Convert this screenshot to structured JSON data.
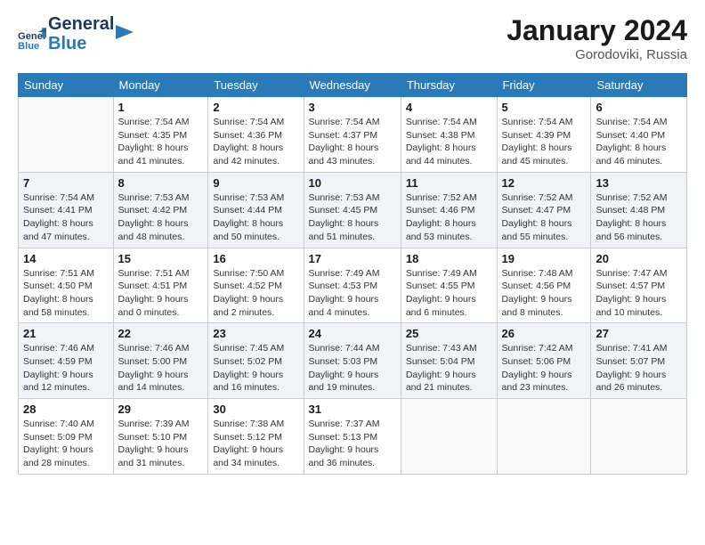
{
  "header": {
    "title": "January 2024",
    "location": "Gorodoviki, Russia"
  },
  "columns": [
    "Sunday",
    "Monday",
    "Tuesday",
    "Wednesday",
    "Thursday",
    "Friday",
    "Saturday"
  ],
  "weeks": [
    [
      {
        "day": "",
        "info": ""
      },
      {
        "day": "1",
        "info": "Sunrise: 7:54 AM\nSunset: 4:35 PM\nDaylight: 8 hours\nand 41 minutes."
      },
      {
        "day": "2",
        "info": "Sunrise: 7:54 AM\nSunset: 4:36 PM\nDaylight: 8 hours\nand 42 minutes."
      },
      {
        "day": "3",
        "info": "Sunrise: 7:54 AM\nSunset: 4:37 PM\nDaylight: 8 hours\nand 43 minutes."
      },
      {
        "day": "4",
        "info": "Sunrise: 7:54 AM\nSunset: 4:38 PM\nDaylight: 8 hours\nand 44 minutes."
      },
      {
        "day": "5",
        "info": "Sunrise: 7:54 AM\nSunset: 4:39 PM\nDaylight: 8 hours\nand 45 minutes."
      },
      {
        "day": "6",
        "info": "Sunrise: 7:54 AM\nSunset: 4:40 PM\nDaylight: 8 hours\nand 46 minutes."
      }
    ],
    [
      {
        "day": "7",
        "info": "Sunrise: 7:54 AM\nSunset: 4:41 PM\nDaylight: 8 hours\nand 47 minutes."
      },
      {
        "day": "8",
        "info": "Sunrise: 7:53 AM\nSunset: 4:42 PM\nDaylight: 8 hours\nand 48 minutes."
      },
      {
        "day": "9",
        "info": "Sunrise: 7:53 AM\nSunset: 4:44 PM\nDaylight: 8 hours\nand 50 minutes."
      },
      {
        "day": "10",
        "info": "Sunrise: 7:53 AM\nSunset: 4:45 PM\nDaylight: 8 hours\nand 51 minutes."
      },
      {
        "day": "11",
        "info": "Sunrise: 7:52 AM\nSunset: 4:46 PM\nDaylight: 8 hours\nand 53 minutes."
      },
      {
        "day": "12",
        "info": "Sunrise: 7:52 AM\nSunset: 4:47 PM\nDaylight: 8 hours\nand 55 minutes."
      },
      {
        "day": "13",
        "info": "Sunrise: 7:52 AM\nSunset: 4:48 PM\nDaylight: 8 hours\nand 56 minutes."
      }
    ],
    [
      {
        "day": "14",
        "info": "Sunrise: 7:51 AM\nSunset: 4:50 PM\nDaylight: 8 hours\nand 58 minutes."
      },
      {
        "day": "15",
        "info": "Sunrise: 7:51 AM\nSunset: 4:51 PM\nDaylight: 9 hours\nand 0 minutes."
      },
      {
        "day": "16",
        "info": "Sunrise: 7:50 AM\nSunset: 4:52 PM\nDaylight: 9 hours\nand 2 minutes."
      },
      {
        "day": "17",
        "info": "Sunrise: 7:49 AM\nSunset: 4:53 PM\nDaylight: 9 hours\nand 4 minutes."
      },
      {
        "day": "18",
        "info": "Sunrise: 7:49 AM\nSunset: 4:55 PM\nDaylight: 9 hours\nand 6 minutes."
      },
      {
        "day": "19",
        "info": "Sunrise: 7:48 AM\nSunset: 4:56 PM\nDaylight: 9 hours\nand 8 minutes."
      },
      {
        "day": "20",
        "info": "Sunrise: 7:47 AM\nSunset: 4:57 PM\nDaylight: 9 hours\nand 10 minutes."
      }
    ],
    [
      {
        "day": "21",
        "info": "Sunrise: 7:46 AM\nSunset: 4:59 PM\nDaylight: 9 hours\nand 12 minutes."
      },
      {
        "day": "22",
        "info": "Sunrise: 7:46 AM\nSunset: 5:00 PM\nDaylight: 9 hours\nand 14 minutes."
      },
      {
        "day": "23",
        "info": "Sunrise: 7:45 AM\nSunset: 5:02 PM\nDaylight: 9 hours\nand 16 minutes."
      },
      {
        "day": "24",
        "info": "Sunrise: 7:44 AM\nSunset: 5:03 PM\nDaylight: 9 hours\nand 19 minutes."
      },
      {
        "day": "25",
        "info": "Sunrise: 7:43 AM\nSunset: 5:04 PM\nDaylight: 9 hours\nand 21 minutes."
      },
      {
        "day": "26",
        "info": "Sunrise: 7:42 AM\nSunset: 5:06 PM\nDaylight: 9 hours\nand 23 minutes."
      },
      {
        "day": "27",
        "info": "Sunrise: 7:41 AM\nSunset: 5:07 PM\nDaylight: 9 hours\nand 26 minutes."
      }
    ],
    [
      {
        "day": "28",
        "info": "Sunrise: 7:40 AM\nSunset: 5:09 PM\nDaylight: 9 hours\nand 28 minutes."
      },
      {
        "day": "29",
        "info": "Sunrise: 7:39 AM\nSunset: 5:10 PM\nDaylight: 9 hours\nand 31 minutes."
      },
      {
        "day": "30",
        "info": "Sunrise: 7:38 AM\nSunset: 5:12 PM\nDaylight: 9 hours\nand 34 minutes."
      },
      {
        "day": "31",
        "info": "Sunrise: 7:37 AM\nSunset: 5:13 PM\nDaylight: 9 hours\nand 36 minutes."
      },
      {
        "day": "",
        "info": ""
      },
      {
        "day": "",
        "info": ""
      },
      {
        "day": "",
        "info": ""
      }
    ]
  ]
}
